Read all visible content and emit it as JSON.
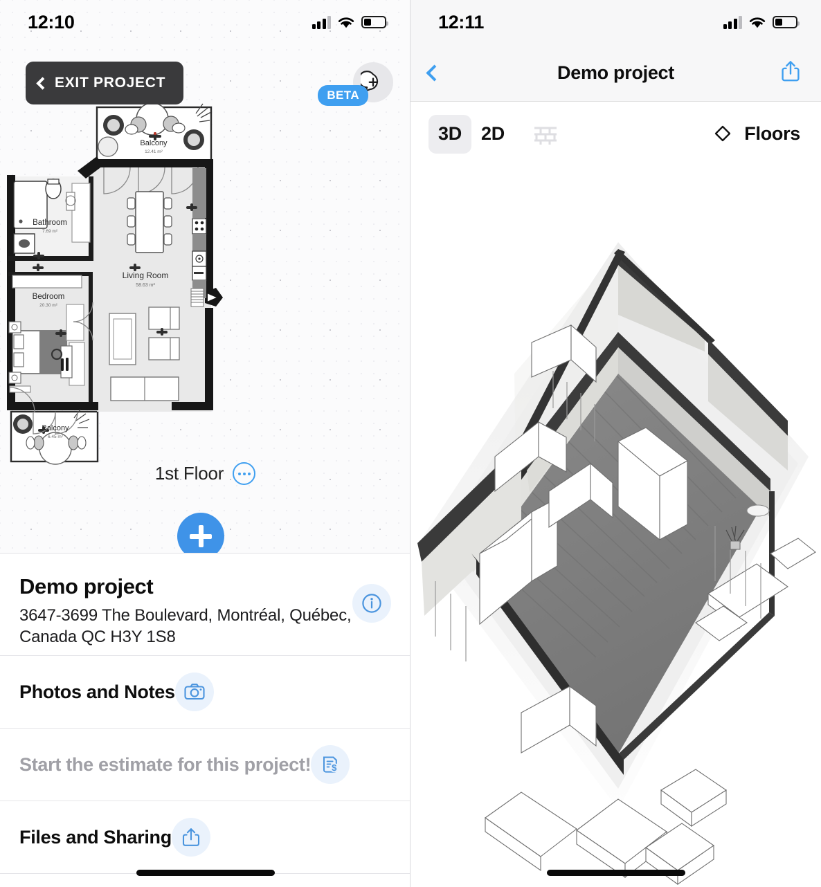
{
  "left_screen": {
    "status_bar": {
      "time": "12:10",
      "signal_icon": "cellular-bars-icon",
      "wifi_icon": "wifi-icon",
      "battery_icon": "battery-icon"
    },
    "exit_button": {
      "label": "EXIT PROJECT",
      "icon": "chevron-left-icon"
    },
    "chat_button": {
      "icon": "chat-plus-icon",
      "badge": "BETA"
    },
    "floor_selector": {
      "label": "1st Floor",
      "more_icon": "ellipsis-icon"
    },
    "add_button": {
      "icon": "plus-icon"
    },
    "floorplan": {
      "rooms": [
        {
          "name": "Balcony",
          "area": "12.41 m²"
        },
        {
          "name": "Bathroom",
          "area": "7.69 m²"
        },
        {
          "name": "Living Room",
          "area": "58.63 m²"
        },
        {
          "name": "Bedroom",
          "area": "20.30 m²"
        },
        {
          "name": "Balcony",
          "area": "6.45 m²"
        }
      ]
    },
    "sheet": {
      "project_title": "Demo project",
      "project_address": "3647-3699 The Boulevard, Montréal, Québec, Canada QC H3Y 1S8",
      "rows": [
        {
          "label": "Photos and Notes",
          "icon": "camera-icon",
          "muted": false
        },
        {
          "label": "Start the estimate for this project!",
          "icon": "estimate-dollar-icon",
          "muted": true
        },
        {
          "label": "Files and Sharing",
          "icon": "share-icon",
          "muted": false
        }
      ],
      "info_icon": "info-icon"
    }
  },
  "right_screen": {
    "status_bar": {
      "time": "12:11",
      "signal_icon": "cellular-bars-icon",
      "wifi_icon": "wifi-icon",
      "battery_icon": "battery-icon"
    },
    "nav": {
      "title": "Demo project",
      "back_icon": "chevron-left-icon",
      "share_icon": "share-icon"
    },
    "toolbar": {
      "view_3d": "3D",
      "view_2d": "2D",
      "walls_icon": "brick-wall-icon",
      "floors_label": "Floors",
      "floors_icon": "chevron-up-down-icon",
      "active_view": "3D"
    }
  },
  "colors": {
    "accent_blue": "#3f9ff0",
    "fab_blue": "#3f93e8",
    "dark_button": "#3a3a3c",
    "icon_bg": "#eaf2fc",
    "muted_text": "#a0a0a6",
    "wall_dark": "#3b3b3b",
    "floor_gray": "#7e7e7e",
    "room_fill": "#e9e9e9"
  }
}
